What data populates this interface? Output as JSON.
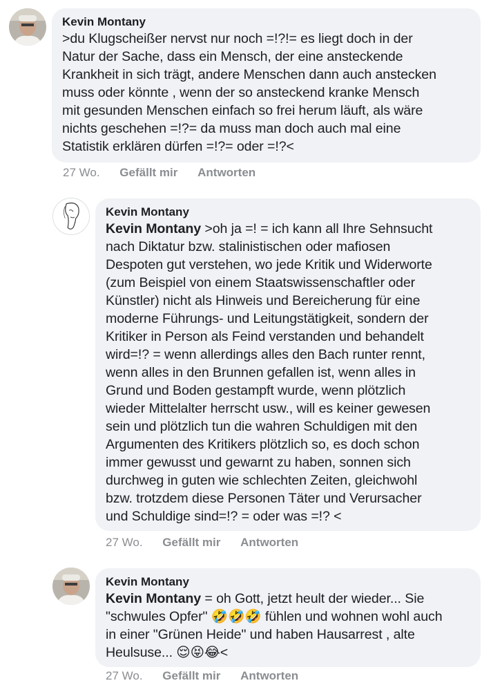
{
  "comments": [
    {
      "author": "Kevin Montany",
      "mention": "",
      "text": ">du Klugscheißer nervst nur noch =!?!= es liegt doch in der\nNatur der Sache, dass ein Mensch, der eine ansteckende\nKrankheit in sich trägt, andere Menschen dann  auch anstecken\nmuss oder könnte , wenn der so ansteckend kranke Mensch\nmit gesunden Menschen einfach so frei herum läuft, als wäre\nnichts geschehen =!?= da muss man doch auch mal eine\nStatistik erklären dürfen =!?= oder =!?<",
      "age": "27 Wo.",
      "like": "Gefällt mir",
      "reply": "Antworten"
    },
    {
      "author": "Kevin Montany",
      "mention": "Kevin Montany",
      "text": " >oh ja =! = ich kann all Ihre Sehnsucht\nnach Diktatur bzw. stalinistischen oder mafiosen\nDespoten gut verstehen, wo jede Kritik und Widerworte\n(zum Beispiel von einem Staatswissenschaftler oder\nKünstler) nicht als Hinweis und Bereicherung für eine\nmoderne Führungs- und Leitungstätigkeit, sondern der\nKritiker in Person als Feind verstanden und behandelt\nwird=!? = wenn allerdings alles den Bach runter rennt,\nwenn alles in den Brunnen gefallen ist, wenn alles in\nGrund und Boden gestampft wurde, wenn plötzlich\nwieder Mittelalter herrscht usw., will es keiner gewesen\nsein und plötzlich tun die wahren Schuldigen mit den\nArgumenten des Kritikers plötzlich so, es doch schon\nimmer gewusst und gewarnt zu haben, sonnen sich\ndurchweg in guten wie schlechten Zeiten, gleichwohl\nbzw. trotzdem diese Personen Täter und Verursacher\nund Schuldige sind=!? = oder was =!? <",
      "age": "27 Wo.",
      "like": "Gefällt mir",
      "reply": "Antworten"
    },
    {
      "author": "Kevin Montany",
      "mention": "Kevin Montany",
      "text": " = oh Gott, jetzt heult der wieder... Sie\n\"schwules Opfer\" 🤣🤣🤣 fühlen und wohnen wohl auch\nin einer  \"Grünen Heide\" und haben Hausarrest , alte\nHeulsuse... 😌😝😂<",
      "age": "27 Wo.",
      "like": "Gefällt mir",
      "reply": "Antworten"
    }
  ],
  "icons": {
    "avatar_photo": "person-photo-avatar",
    "avatar_sketch": "sketch-face-avatar"
  },
  "colors": {
    "bubble": "#f0f2f5",
    "meta": "#8a8d91",
    "text": "#1c1e21"
  }
}
